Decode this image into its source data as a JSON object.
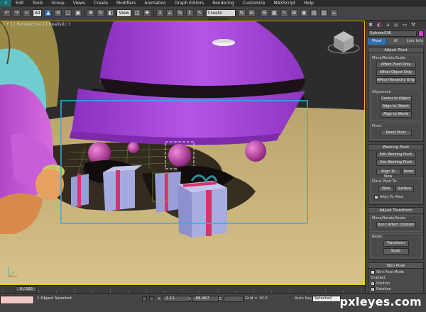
{
  "app": {
    "logo": "3",
    "menu": [
      "Edit",
      "Tools",
      "Group",
      "Views",
      "Create",
      "Modifiers",
      "Animation",
      "Graph Editors",
      "Rendering",
      "Customize",
      "MAXScript",
      "Help"
    ]
  },
  "toolbar": {
    "filter_select": "All",
    "view_select": "View",
    "selection_set": "Create Selection Set"
  },
  "viewport": {
    "label": "[ + ] [ Perspective ] [ Realistic ]"
  },
  "panel": {
    "tabs": [
      "create-icon",
      "modify-icon",
      "hierarchy-icon",
      "motion-icon",
      "display-icon",
      "utilities-icon"
    ],
    "object_name": "Sphere036",
    "object_color": "#d63cd1",
    "subtabs": [
      "Pivot",
      "IK",
      "Link Info"
    ],
    "adjust_pivot": {
      "title": "Adjust Pivot",
      "group_move": "Move/Rotate/Scale:",
      "affect_pivot": "Affect Pivot Only",
      "affect_object": "Affect Object Only",
      "affect_hierarchy": "Affect Hierarchy Only",
      "group_align": "Alignment:",
      "center_to_object": "Center to Object",
      "align_to_object": "Align to Object",
      "align_to_world": "Align to World",
      "group_pivot": "Pivot:",
      "reset_pivot": "Reset Pivot"
    },
    "working_pivot": {
      "title": "Working Pivot",
      "edit_wp": "Edit Working Pivot",
      "use_wp": "Use Working Pivot",
      "align_to_view": "Align To View",
      "reset": "Reset",
      "place_pivot_to": "Place Pivot To:",
      "view": "View",
      "surface": "Surface",
      "align_to_view_chk": "Align To View"
    },
    "adjust_transform": {
      "title": "Adjust Transform",
      "group_move": "Move/Rotate/Scale:",
      "dont_affect_children": "Don't Affect Children",
      "group_reset": "Reset:",
      "transform": "Transform",
      "scale": "Scale"
    },
    "skin_pose": {
      "title": "Skin Pose",
      "skin_pose_mode": "Skin Pose Mode",
      "enabled": "Enabled:",
      "position": "Position",
      "rotation": "Rotation"
    }
  },
  "timeslider": {
    "frame": "0 / 100"
  },
  "status": {
    "message": "1 Object Selected",
    "x_label": "X:",
    "x_value": "-1.11",
    "y_label": "Y:",
    "y_value": "-88.367",
    "z_label": "Z:",
    "z_value": "",
    "grid": "Grid = 10.0",
    "autokey": "Auto Key",
    "selected": "Selected",
    "watermark": "pxleyes.com"
  },
  "colors": {
    "selection_box": "#2fb0e0",
    "tree": "#a543d6",
    "floor": "#c9b37a",
    "ornament": "#c03fa8",
    "gift": "#9a9ed8",
    "ribbon": "#d4356b"
  }
}
